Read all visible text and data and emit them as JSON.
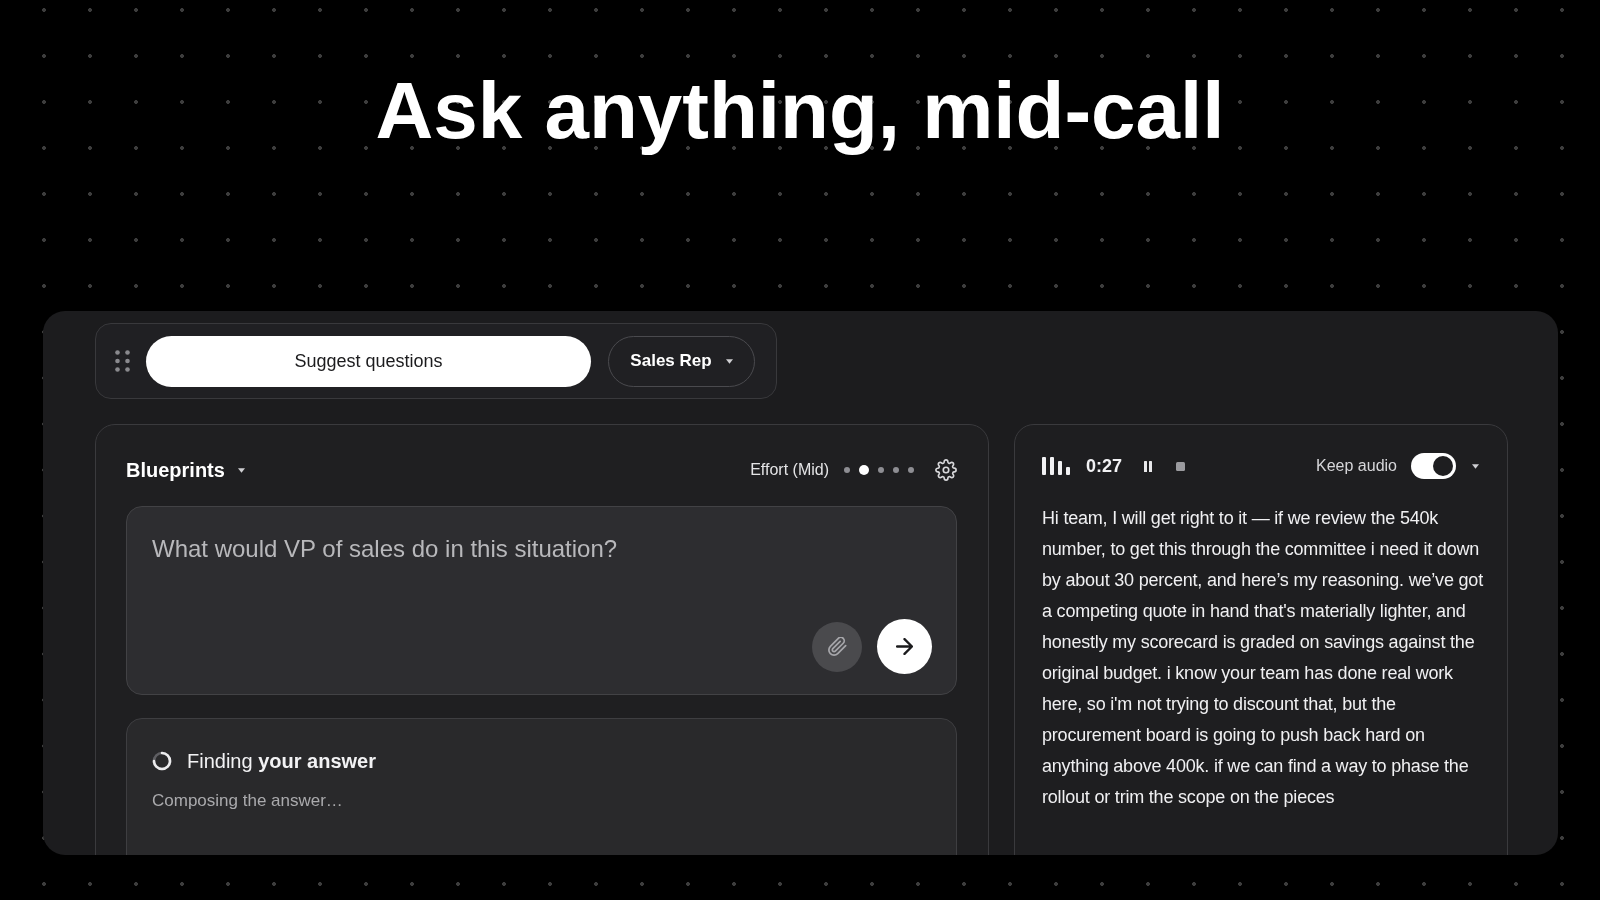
{
  "headline": "Ask anything, mid-call",
  "toolbar": {
    "suggest_button": "Suggest questions",
    "role_dropdown": {
      "label": "Sales Rep"
    }
  },
  "blueprints_panel": {
    "title": "Blueprints",
    "effort": {
      "label": "Effort (Mid)",
      "steps": [
        {
          "selected": false
        },
        {
          "selected": true
        },
        {
          "selected": false
        },
        {
          "selected": false
        },
        {
          "selected": false
        }
      ]
    },
    "question": {
      "placeholder": "What would VP of sales do in this situation?"
    },
    "status": {
      "title": "Finding **your answer**",
      "detail": "Composing the answer…"
    }
  },
  "recorder_panel": {
    "time": "0:27",
    "keep_audio": {
      "label": "Keep audio",
      "on": true
    },
    "transcript": "Hi team, I will get right to it — if we review the 540k number, to get this through the committee i need it down by about 30 percent, and here’s my reasoning. we’ve got a competing quote in hand that's materially lighter, and honestly my scorecard is graded on savings against the original budget. i know your team has done real work here, so i'm not trying to discount that, but the procurement board is going to push back hard on anything above 400k. if we can find a way to phase the rollout or trim the scope on the pieces"
  }
}
